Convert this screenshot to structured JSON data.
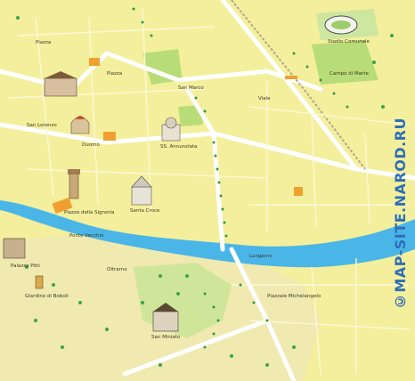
{
  "map": {
    "watermark": "©MAP-SITE.NAROD.RU",
    "colors": {
      "land": "#f4ef9c",
      "hill": "#efe8a8",
      "river": "#4ab6e8",
      "road": "#ffffff",
      "park": "#b8dd78",
      "tree": "#2f9a45",
      "landmark": "#f0a030",
      "watermark": "#2f6fb6"
    },
    "labels": {
      "piazza_top": "Piazza",
      "piazza_stazione": "Piazza",
      "san_lorenzo": "San Lorenzo",
      "duomo": "Duomo",
      "piazza_signoria": "Piazza della Signoria",
      "santa_croce": "Santa Croce",
      "ponte_vecchio": "Ponte Vecchio",
      "palazzo_pitti": "Palazzo Pitti",
      "giardino": "Giardino di Boboli",
      "san_miniato": "San Miniato",
      "campo_marte": "Campo di Marte",
      "stadio": "Stadio Comunale",
      "lungarno": "Lungarno",
      "piazzale": "Piazzale Michelangelo",
      "santissima": "SS. Annunziata",
      "san_marco": "San Marco",
      "viale_top": "Viale",
      "oltrarno": "Oltrarno"
    }
  }
}
